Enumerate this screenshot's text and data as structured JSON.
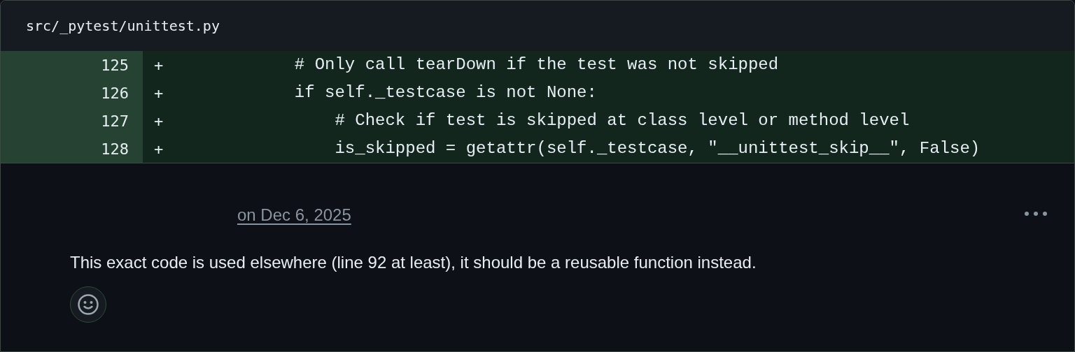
{
  "file": {
    "path": "src/_pytest/unittest.py"
  },
  "diff_lines": [
    {
      "number": "125",
      "sign": "+",
      "kind": "added",
      "code": "            # Only call tearDown if the test was not skipped"
    },
    {
      "number": "126",
      "sign": "+",
      "kind": "added",
      "code": "            if self._testcase is not None:"
    },
    {
      "number": "127",
      "sign": "+",
      "kind": "added",
      "code": "                # Check if test is skipped at class level or method level"
    },
    {
      "number": "128",
      "sign": "+",
      "kind": "added",
      "code": "                is_skipped = getattr(self._testcase, \"__unittest_skip__\", False)"
    }
  ],
  "comment": {
    "date": "on Dec 6, 2025",
    "body": "This exact code is used elsewhere (line 92 at least), it should be a reusable function instead."
  }
}
